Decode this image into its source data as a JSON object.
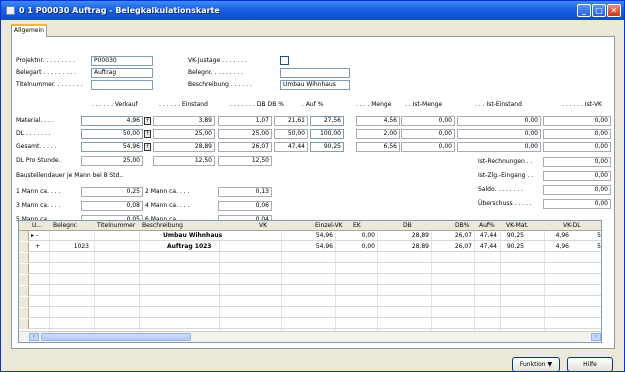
{
  "window": {
    "title": "0 1 P00030 Auftrag - Belegkalkulationskarte"
  },
  "tabs": [
    {
      "label": "Allgemein"
    }
  ],
  "header": {
    "projektnr_label": "Projektnr. . . . . . . . .",
    "projektnr_value": "P00030",
    "belegart_label": "Belegart . . . . . . . . .",
    "belegart_value": "Auftrag",
    "titelnummer_label": "Titelnummer. . . . . . . .",
    "titelnummer_value": "",
    "vkjustage_label": "VK-Justage . . . . . . .",
    "belegnr_label": "Belegnr. . . . . . . . .",
    "belegnr_value": "",
    "beschreibung_label": "Beschreibung . . . . . .",
    "beschreibung_value": "Umbau Wihnhaus"
  },
  "columns": {
    "verkauf": ". . . . . . Verkauf",
    "einstand": ". . . . . . Einstand",
    "db": ". . . . . . . DB",
    "dbpct": ". . DB %",
    "aufpct": ". Auf %",
    "menge": ". . . . Menge",
    "istmenge": ". . Ist-Menge",
    "isteinstand": ". . . Ist-Einstand",
    "istvk": ". . . . . . Ist-VK"
  },
  "rows": [
    {
      "label": "Material. . . .",
      "verkauf": "4,96",
      "einstand": "3,89",
      "db": "1,07",
      "dbpct": "21,61",
      "aufpct": "27,56",
      "menge": "4,56",
      "istmenge": "0,00",
      "isteinstand": "0,00",
      "istvk": "0,00"
    },
    {
      "label": "DL . . . . . . .",
      "verkauf": "50,00",
      "einstand": "25,00",
      "db": "25,00",
      "dbpct": "50,00",
      "aufpct": "100,00",
      "menge": "2,00",
      "istmenge": "0,00",
      "isteinstand": "0,00",
      "istvk": "0,00"
    },
    {
      "label": "Gesamt. . . . .",
      "verkauf": "54,96",
      "einstand": "28,89",
      "db": "26,07",
      "dbpct": "47,44",
      "aufpct": "90,25",
      "menge": "6,56",
      "istmenge": "0,00",
      "isteinstand": "0,00",
      "istvk": "0,00"
    },
    {
      "label": "DL Pro Stunde.",
      "verkauf": "25,00",
      "einstand": "12,50",
      "db": "12,50"
    }
  ],
  "baustelle": {
    "title": "Baustellendauer je Mann bei 8 Std..",
    "m1_label": "1 Mann ca. . . .",
    "m1_value": "0,25",
    "m2_label": "2 Mann ca. . . .",
    "m2_value": "0,13",
    "m3_label": "3 Mann ca. . . .",
    "m3_value": "0,08",
    "m4_label": "4 Mann ca. . . .",
    "m4_value": "0,06",
    "m5_label": "5 Mann ca. . . .",
    "m5_value": "0,05",
    "m6_label": "6 Mann ca. . . .",
    "m6_value": "0,04"
  },
  "ist": {
    "rechnungen_label": "Ist-Rechnungen . .",
    "rechnungen_value": "0,00",
    "zlg_label": "Ist-Zlg.-Eingang . .",
    "zlg_value": "0,00",
    "saldo_label": "Saldo. . . . . . . .",
    "saldo_value": "0,00",
    "ueberschuss_label": "Überschuss . . . . .",
    "ueberschuss_value": "0,00"
  },
  "grid": {
    "headers": [
      "U...",
      "Belegnr.",
      "Titelnummer",
      "Beschreibung",
      "VK",
      "Einzel-VK",
      "EK",
      "DB",
      "DB%",
      "Auf%",
      "VK-Mat.",
      "VK-DL"
    ],
    "rows": [
      {
        "marker": "▸ -",
        "u": "",
        "belegnr": "",
        "titel": "",
        "beschreibung": "Umbau Wihnhaus",
        "vk": "54,96",
        "einzelvk": "0,00",
        "ek": "28,89",
        "db": "26,07",
        "dbpct": "47,44",
        "aufpct": "90,25",
        "vkmat": "4,96",
        "vkdl": "5"
      },
      {
        "marker": "+",
        "u": "",
        "belegnr": "1023",
        "titel": "",
        "beschreibung": "Auftrag 1023",
        "vk": "54,96",
        "einzelvk": "0,00",
        "ek": "28,89",
        "db": "26,07",
        "dbpct": "47,44",
        "aufpct": "90,25",
        "vkmat": "4,96",
        "vkdl": "5"
      }
    ]
  },
  "buttons": {
    "funktion": "Funktion",
    "hilfe": "Hilfe"
  },
  "colors": {
    "titlebar": "#1a5fe0",
    "window_bg": "#ece9d8",
    "field_border": "#7f9db9"
  }
}
